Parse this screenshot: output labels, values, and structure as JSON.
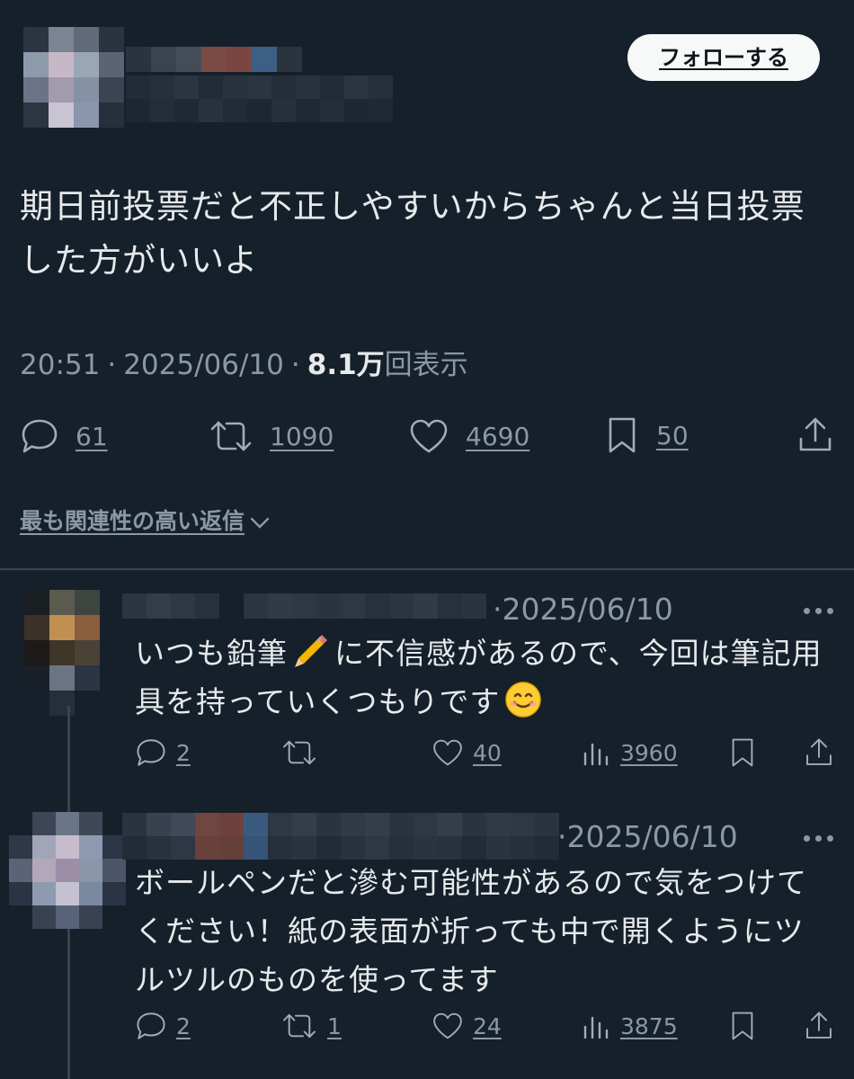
{
  "post": {
    "follow_label": "フォローする",
    "text": "期日前投票だと不正しやすいからちゃんと当日投票した方がいいよ",
    "time": "20:51",
    "date": "2025/06/10",
    "separator": "·",
    "views_count": "8.1万",
    "views_label": "回表示",
    "stats": {
      "replies": "61",
      "reposts": "1090",
      "likes": "4690",
      "bookmarks": "50"
    }
  },
  "replies_sort": {
    "label": "最も関連性の高い返信"
  },
  "replies": [
    {
      "date": "·2025/06/10",
      "text_before_emoji": "いつも鉛筆",
      "text_after_emoji": "に不信感があるので、今回は筆記用具を持っていくつもりです",
      "stats": {
        "replies": "2",
        "reposts": "",
        "likes": "40",
        "views": "3960"
      }
    },
    {
      "date": "·2025/06/10",
      "text": "ボールペンだと滲む可能性があるので気をつけてください！紙の表面が折っても中で開くようにツルツルのものを使ってます",
      "stats": {
        "replies": "2",
        "reposts": "1",
        "likes": "24",
        "views": "3875"
      }
    }
  ],
  "colors": {
    "background": "#15202b",
    "text_primary": "#e7e9ea",
    "text_secondary": "#8b98a5",
    "divider": "#38444d",
    "button_bg": "#f7f9f9"
  },
  "icons": [
    "reply-icon",
    "repost-icon",
    "like-icon",
    "bookmark-icon",
    "share-icon",
    "views-icon",
    "more-icon",
    "chevron-down-icon",
    "pencil-emoji",
    "smile-emoji"
  ]
}
